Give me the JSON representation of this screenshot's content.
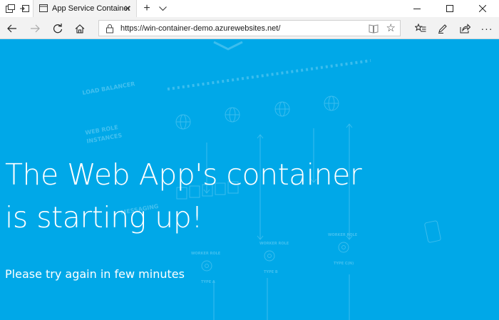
{
  "browser": {
    "tab": {
      "title": "App Service Container",
      "active": true
    },
    "address": {
      "url": "https://win-container-demo.azurewebsites.net/"
    },
    "icons": {
      "tab_actions": "tab-actions-icon",
      "set_aside_tabs": "set-aside-tabs-icon",
      "new_tab": "plus-icon",
      "tab_list": "chevron-down-icon",
      "back": "arrow-left-icon",
      "forward": "arrow-right-icon",
      "refresh": "refresh-icon",
      "home": "home-icon",
      "lock": "lock-icon",
      "reading_view": "book-icon",
      "favorite": "star-icon",
      "favorites_hub": "favorites-list-icon",
      "notes": "pen-icon",
      "share": "share-icon",
      "more": "more-icon"
    }
  },
  "page": {
    "background_color": "#00a8e8",
    "headline_line1": "The Web App's container",
    "headline_line2": "is starting up!",
    "subline": "Please try again in few minutes",
    "diagram_labels": {
      "load_balancer": "LOAD BALANCER",
      "web_role_line1": "WEB ROLE",
      "web_role_line2": "INSTANCES",
      "messaging": "MESSAGING",
      "worker_role_1": "WORKER ROLE",
      "worker_role_2": "WORKER ROLE",
      "worker_role_3": "WORKER ROLE",
      "type_a": "TYPE A",
      "type_b": "TYPE B",
      "type_c": "TYPE C(N)"
    }
  }
}
